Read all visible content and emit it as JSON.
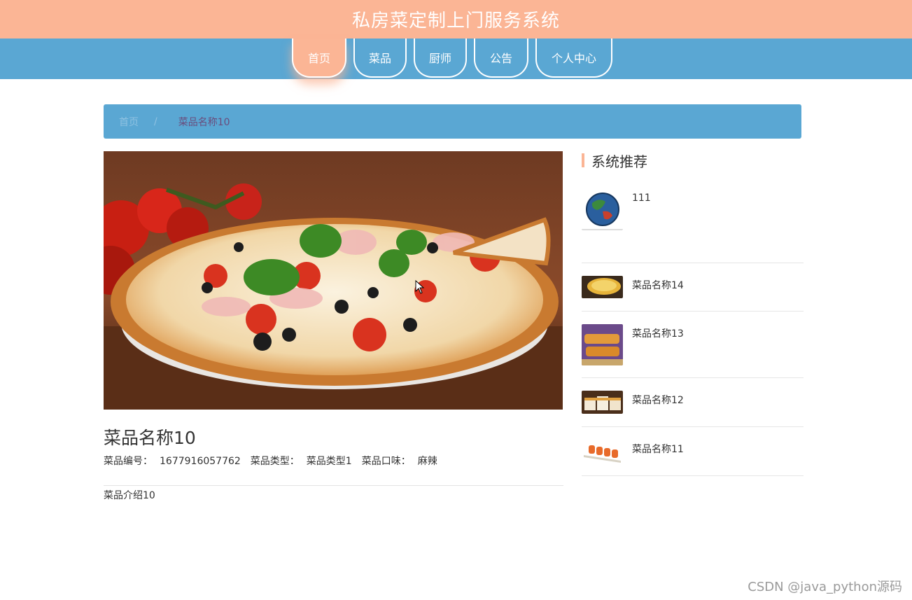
{
  "header": {
    "title": "私房菜定制上门服务系统"
  },
  "nav": {
    "items": [
      {
        "label": "首页",
        "active": true
      },
      {
        "label": "菜品",
        "active": false
      },
      {
        "label": "厨师",
        "active": false
      },
      {
        "label": "公告",
        "active": false
      },
      {
        "label": "个人中心",
        "active": false
      }
    ]
  },
  "breadcrumb": {
    "home": "首页",
    "separator": "/",
    "current": "菜品名称10"
  },
  "dish": {
    "title": "菜品名称10",
    "number_label": "菜品编号：",
    "number_value": "1677916057762",
    "type_label": "菜品类型：",
    "type_value": "菜品类型1",
    "taste_label": "菜品口味：",
    "taste_value": "麻辣",
    "intro": "菜品介绍10",
    "image_icon": "pizza-photo"
  },
  "sidebar": {
    "title": "系统推荐",
    "items": [
      {
        "label": "111",
        "thumb": "globe"
      },
      {
        "label": "菜品名称14",
        "thumb": "egg-tart"
      },
      {
        "label": "菜品名称13",
        "thumb": "pastry"
      },
      {
        "label": "菜品名称12",
        "thumb": "cake-slices"
      },
      {
        "label": "菜品名称11",
        "thumb": "sushi-rolls"
      }
    ]
  },
  "watermark": "CSDN @java_python源码",
  "colors": {
    "header_bg": "#fbb595",
    "nav_bg": "#5aa7d3",
    "accent": "#fbb595"
  }
}
